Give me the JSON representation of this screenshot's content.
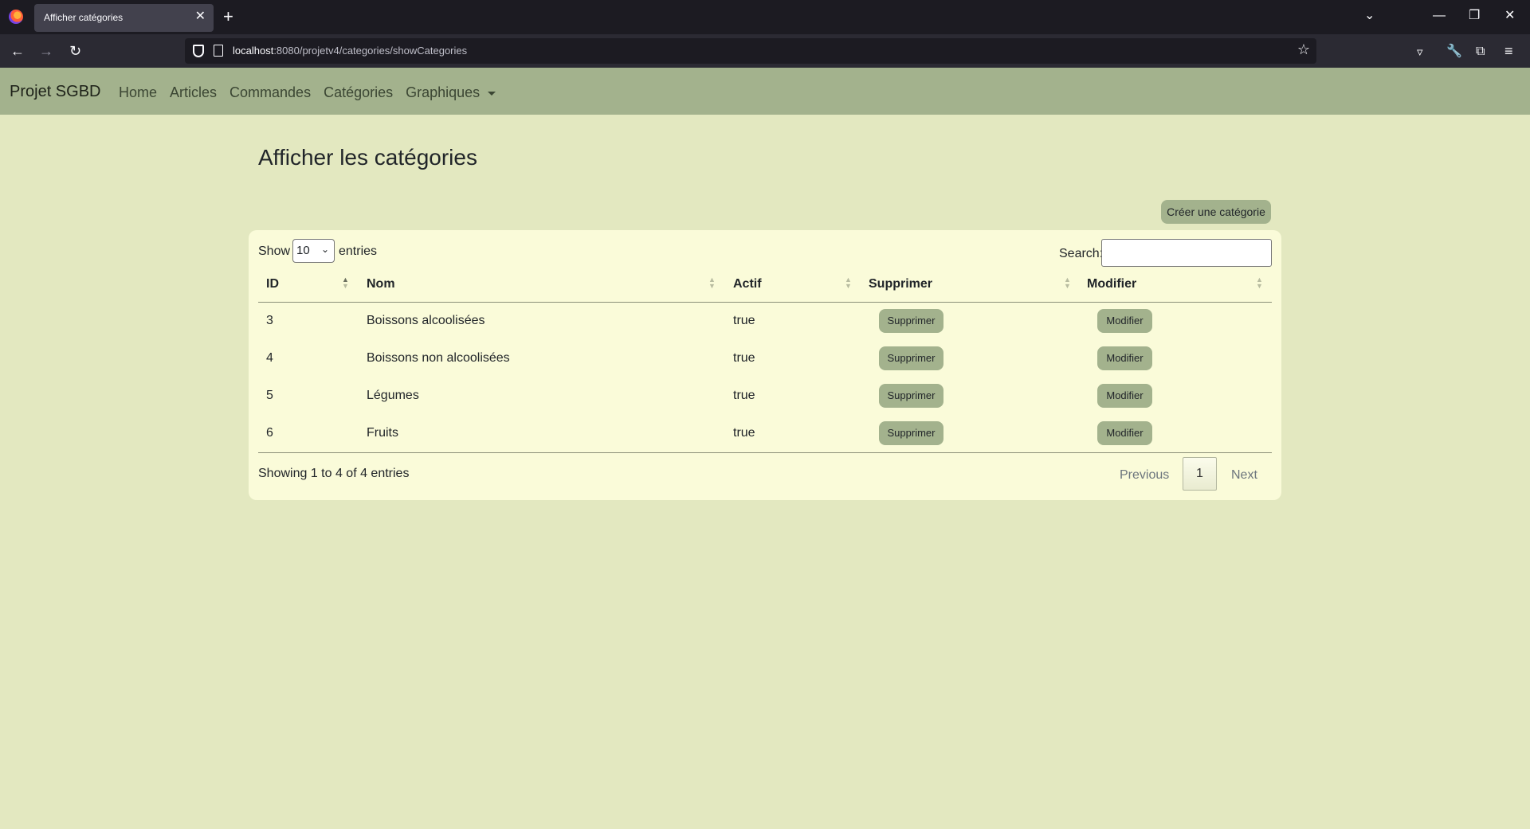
{
  "browser": {
    "tab_title": "Afficher catégories",
    "url_host": "localhost",
    "url_rest": ":8080/projetv4/categories/showCategories"
  },
  "appnav": {
    "brand": "Projet SGBD",
    "links": [
      "Home",
      "Articles",
      "Commandes",
      "Catégories",
      "Graphiques"
    ]
  },
  "page": {
    "title": "Afficher les catégories",
    "create_button": "Créer une catégorie"
  },
  "table_controls": {
    "show_label": "Show",
    "page_size": "10",
    "entries_label": "entries",
    "search_label": "Search:",
    "search_value": ""
  },
  "table": {
    "columns": [
      "ID",
      "Nom",
      "Actif",
      "Supprimer",
      "Modifier"
    ],
    "rows": [
      {
        "id": "3",
        "nom": "Boissons alcoolisées",
        "actif": "true",
        "delete": "Supprimer",
        "edit": "Modifier"
      },
      {
        "id": "4",
        "nom": "Boissons non alcoolisées",
        "actif": "true",
        "delete": "Supprimer",
        "edit": "Modifier"
      },
      {
        "id": "5",
        "nom": "Légumes",
        "actif": "true",
        "delete": "Supprimer",
        "edit": "Modifier"
      },
      {
        "id": "6",
        "nom": "Fruits",
        "actif": "true",
        "delete": "Supprimer",
        "edit": "Modifier"
      }
    ]
  },
  "footer": {
    "info": "Showing 1 to 4 of 4 entries",
    "previous": "Previous",
    "current_page": "1",
    "next": "Next"
  },
  "colors": {
    "page_bg": "#e3e8c0",
    "navbar_bg": "#a3b28d",
    "card_bg": "#fafbd9",
    "button_bg": "#a3b28d"
  }
}
